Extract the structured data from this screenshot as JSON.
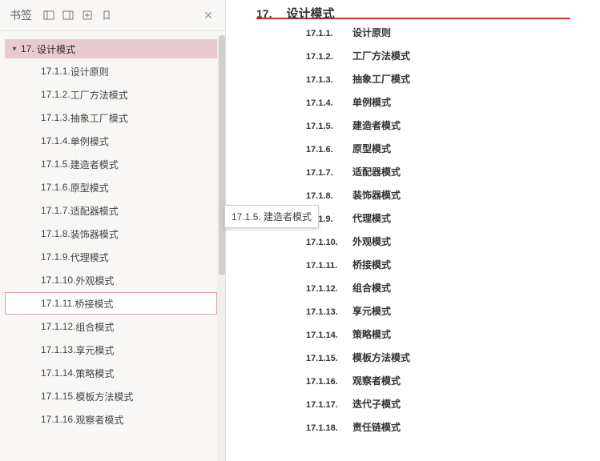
{
  "sidebar": {
    "title": "书签",
    "close_icon": "✕",
    "chapter": {
      "num": "17.",
      "title": "设计模式"
    },
    "items": [
      {
        "num": "17.1.1.",
        "title": "设计原则"
      },
      {
        "num": "17.1.2.",
        "title": "工厂方法模式"
      },
      {
        "num": "17.1.3.",
        "title": "抽象工厂模式"
      },
      {
        "num": "17.1.4.",
        "title": "单例模式"
      },
      {
        "num": "17.1.5.",
        "title": "建造者模式"
      },
      {
        "num": "17.1.6.",
        "title": "原型模式"
      },
      {
        "num": "17.1.7.",
        "title": "适配器模式"
      },
      {
        "num": "17.1.8.",
        "title": "装饰器模式"
      },
      {
        "num": "17.1.9.",
        "title": "代理模式"
      },
      {
        "num": "17.1.10.",
        "title": "外观模式"
      },
      {
        "num": "17.1.11.",
        "title": "桥接模式"
      },
      {
        "num": "17.1.12.",
        "title": "组合模式"
      },
      {
        "num": "17.1.13.",
        "title": "享元模式"
      },
      {
        "num": "17.1.14.",
        "title": "策略模式"
      },
      {
        "num": "17.1.15.",
        "title": "模板方法模式"
      },
      {
        "num": "17.1.16.",
        "title": "观察者模式"
      }
    ],
    "selected_index": 10
  },
  "tooltip": {
    "text": "17.1.5. 建造者模式"
  },
  "document": {
    "num": "17.",
    "title": "设计模式",
    "entries": [
      {
        "num": "17.1.1.",
        "title": "设计原则"
      },
      {
        "num": "17.1.2.",
        "title": "工厂方法模式"
      },
      {
        "num": "17.1.3.",
        "title": "抽象工厂模式"
      },
      {
        "num": "17.1.4.",
        "title": "单例模式"
      },
      {
        "num": "17.1.5.",
        "title": "建造者模式"
      },
      {
        "num": "17.1.6.",
        "title": "原型模式"
      },
      {
        "num": "17.1.7.",
        "title": "适配器模式"
      },
      {
        "num": "17.1.8.",
        "title": "装饰器模式"
      },
      {
        "num": "17.1.9.",
        "title": "代理模式"
      },
      {
        "num": "17.1.10.",
        "title": "外观模式"
      },
      {
        "num": "17.1.11.",
        "title": "桥接模式"
      },
      {
        "num": "17.1.12.",
        "title": "组合模式"
      },
      {
        "num": "17.1.13.",
        "title": "享元模式"
      },
      {
        "num": "17.1.14.",
        "title": "策略模式"
      },
      {
        "num": "17.1.15.",
        "title": "模板方法模式"
      },
      {
        "num": "17.1.16.",
        "title": "观察者模式"
      },
      {
        "num": "17.1.17.",
        "title": "迭代子模式"
      },
      {
        "num": "17.1.18.",
        "title": "责任链模式"
      }
    ]
  }
}
